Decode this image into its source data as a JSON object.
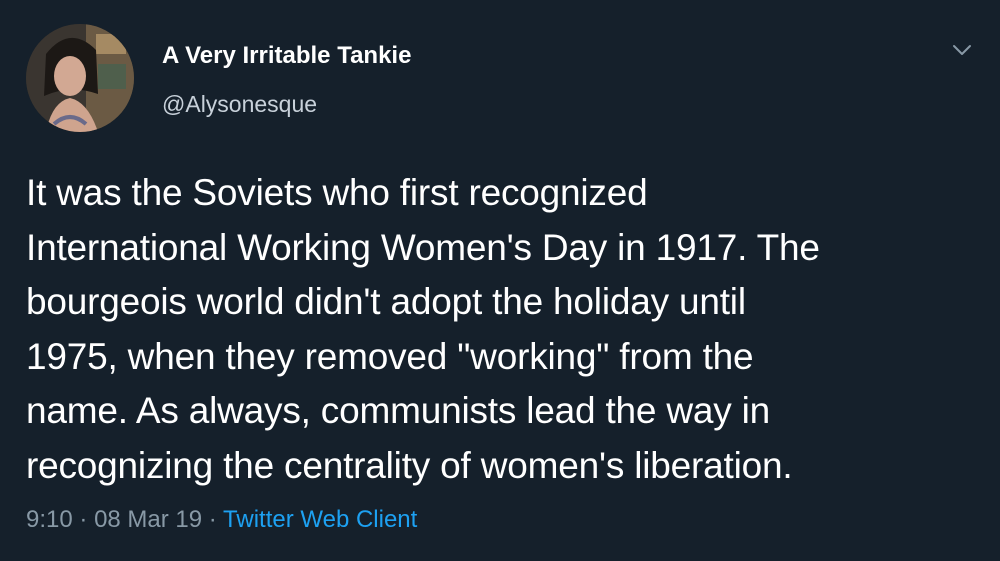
{
  "tweet": {
    "author": {
      "display_name": "A Very Irritable Tankie",
      "handle": "@Alysonesque"
    },
    "text_lines": [
      "It was the Soviets who first recognized",
      "International Working Women's Day in 1917. The",
      "bourgeois world didn't adopt the holiday until",
      "1975, when they removed \"working\" from the",
      "name. As always, communists lead the way in",
      "recognizing the centrality of women's liberation."
    ],
    "time": "9:10",
    "separator": "·",
    "date": "08 Mar 19",
    "source": "Twitter Web Client"
  },
  "icons": {
    "more_menu": "chevron-down-icon"
  },
  "colors": {
    "background": "#15202b",
    "text": "#ffffff",
    "secondary_text": "#8899a6",
    "link": "#1da1f2"
  }
}
